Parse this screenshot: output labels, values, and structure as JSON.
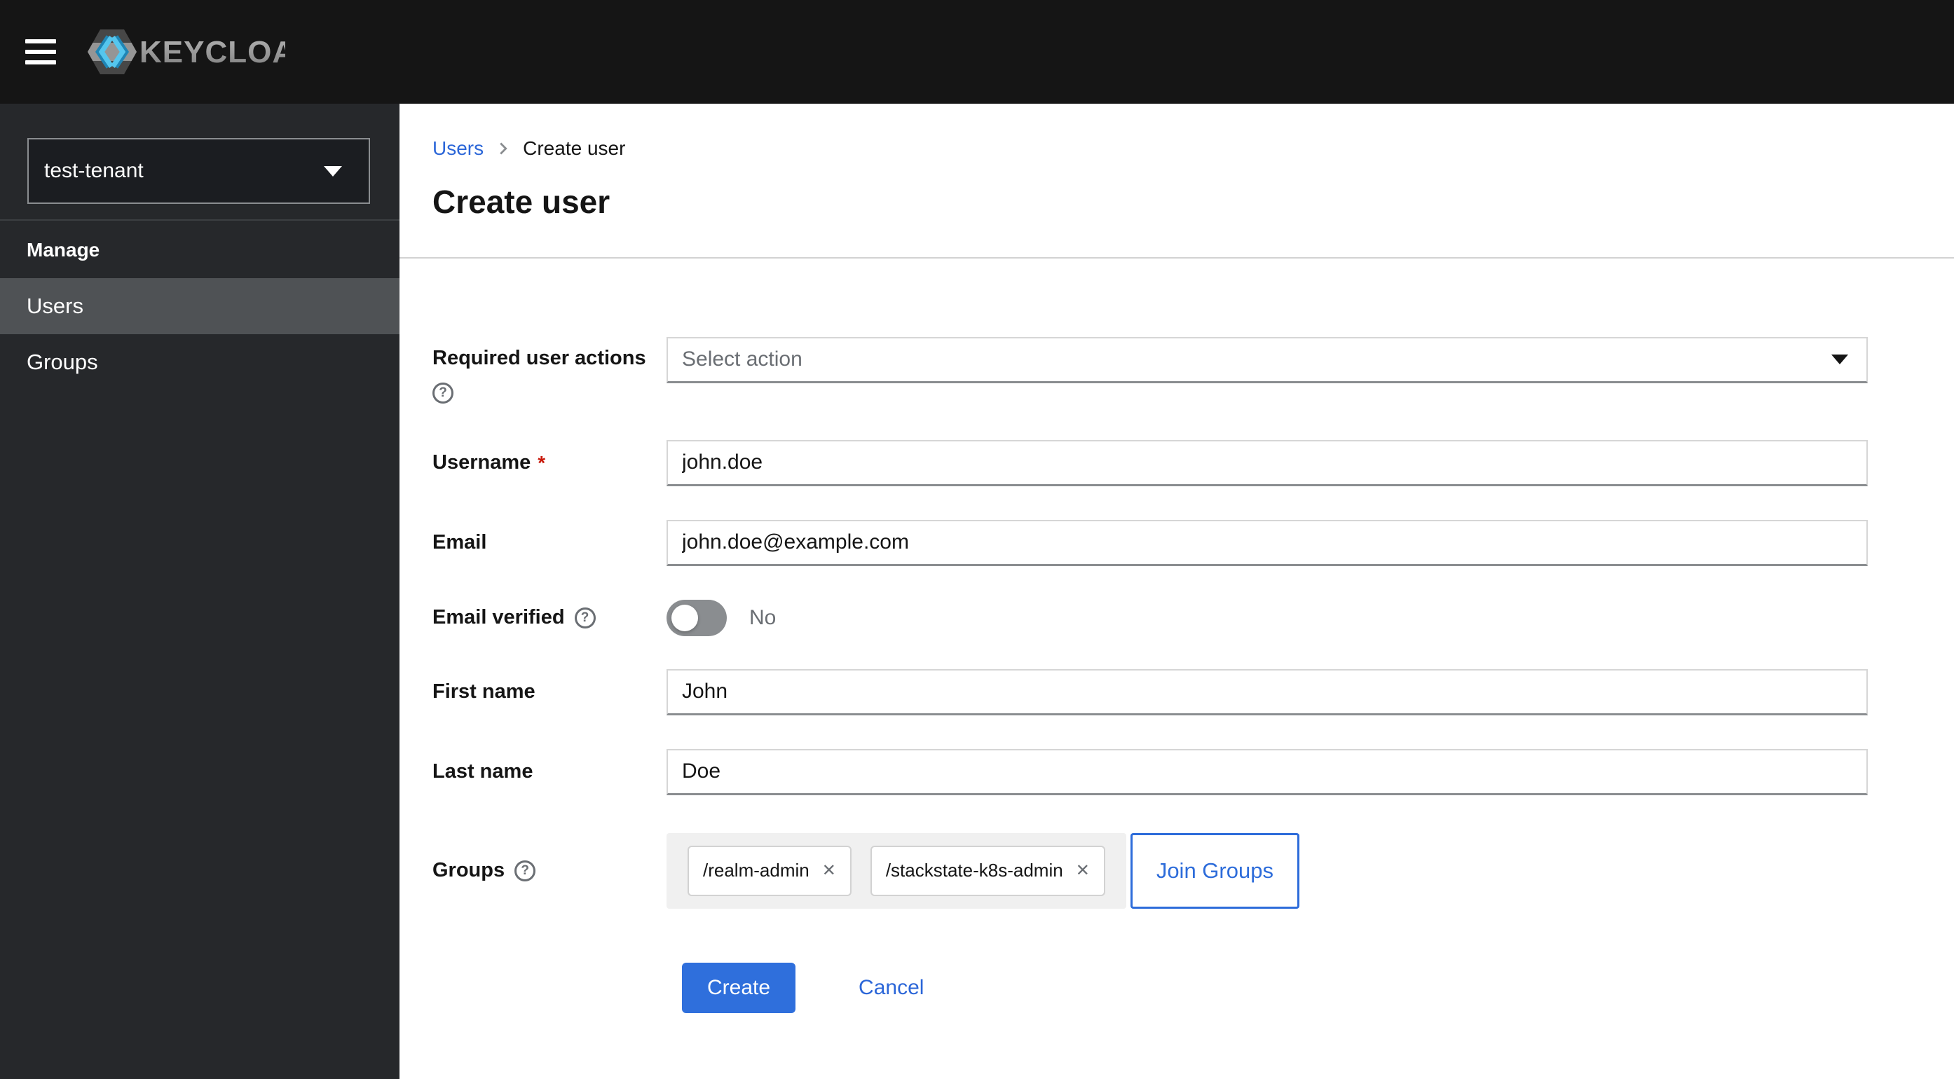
{
  "header": {
    "brand": "KEYCLOAK"
  },
  "sidebar": {
    "realm_selector": {
      "value": "test-tenant"
    },
    "section_title": "Manage",
    "items": [
      {
        "label": "Users",
        "selected": true
      },
      {
        "label": "Groups",
        "selected": false
      }
    ]
  },
  "breadcrumb": {
    "parent": "Users",
    "current": "Create user"
  },
  "page": {
    "title": "Create user"
  },
  "form": {
    "required_user_actions": {
      "label": "Required user actions",
      "placeholder": "Select action"
    },
    "username": {
      "label": "Username",
      "value": "john.doe",
      "required_marker": "*"
    },
    "email": {
      "label": "Email",
      "value": "john.doe@example.com"
    },
    "email_verified": {
      "label": "Email verified",
      "state": "No"
    },
    "first_name": {
      "label": "First name",
      "value": "John"
    },
    "last_name": {
      "label": "Last name",
      "value": "Doe"
    },
    "groups": {
      "label": "Groups",
      "chips": [
        "/realm-admin",
        "/stackstate-k8s-admin"
      ],
      "remove_icon": "✕",
      "join_button": "Join Groups"
    },
    "actions": {
      "create": "Create",
      "cancel": "Cancel"
    },
    "help_glyph": "?"
  },
  "colors": {
    "header_bg": "#151515",
    "sidebar_bg": "#26282b",
    "nav_selected": "#4f5255",
    "accent_blue": "#2b66d8",
    "primary_button_blue": "#2f6fdc",
    "required_red": "#c9190b",
    "muted_gray": "#6a6e73",
    "border_gray": "#d2d2d2"
  }
}
